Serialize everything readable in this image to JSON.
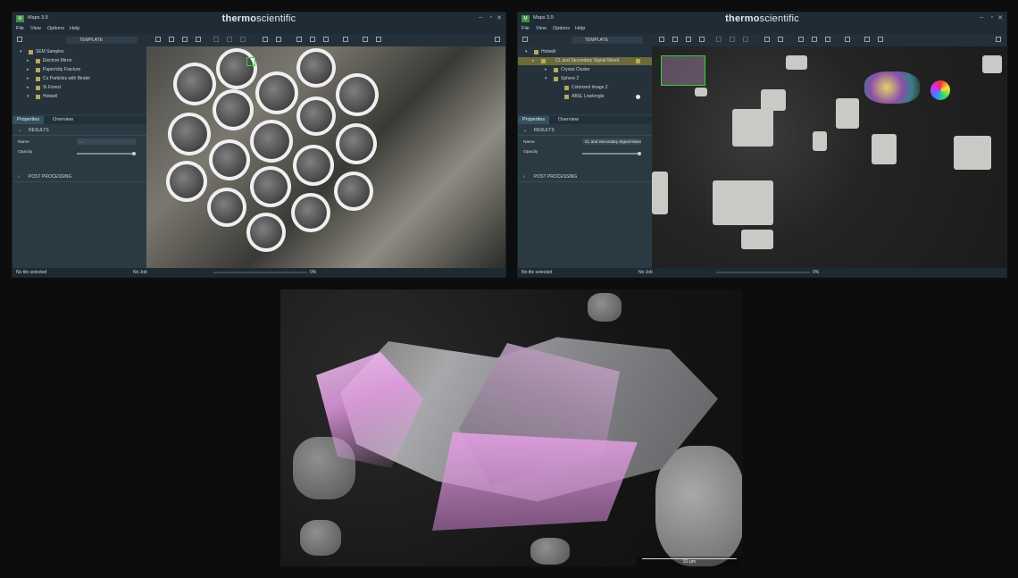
{
  "window_left": {
    "app_title": "Maps 3.9",
    "brand_bold": "thermo",
    "brand_light": "scientific",
    "menu": [
      "File",
      "View",
      "Options",
      "Help"
    ],
    "template_label": "TEMPLATE",
    "tree": [
      {
        "label": "SEM Samples",
        "indent": 0
      },
      {
        "label": "Electron Mirror",
        "indent": 1
      },
      {
        "label": "Paper/clip Fracture",
        "indent": 1
      },
      {
        "label": "Cu Particles with Binder",
        "indent": 1
      },
      {
        "label": "Si Forest",
        "indent": 1
      },
      {
        "label": "Hotwell",
        "indent": 1
      }
    ],
    "tabs": [
      "Properties",
      "Overview"
    ],
    "results_label": "RESULTS",
    "name_label": "Name",
    "name_value": "...",
    "opacity_label": "Opacity",
    "post_processing_label": "POST PROCESSING",
    "status_left": "No tile selected",
    "status_job": "No Job",
    "status_percent": "0%"
  },
  "window_right": {
    "app_title": "Maps 3.9",
    "brand_bold": "thermo",
    "brand_light": "scientific",
    "menu": [
      "File",
      "View",
      "Options",
      "Help"
    ],
    "template_label": "TEMPLATE",
    "tree": [
      {
        "label": "Hotwell",
        "indent": 0
      },
      {
        "label": "CL and Secondary Signal Mixed",
        "indent": 1
      },
      {
        "label": "Crystal Cluster",
        "indent": 1
      },
      {
        "label": "Sphere 2",
        "indent": 1
      },
      {
        "label": "Colorized Image 2",
        "indent": 2
      },
      {
        "label": "ABSL Lowlongle",
        "indent": 2
      }
    ],
    "tabs": [
      "Properties",
      "Overview"
    ],
    "results_label": "RESULTS",
    "name_label": "Name",
    "name_value": "CL and Secondary Signal Mixed",
    "opacity_label": "Opacity",
    "post_processing_label": "POST PROCESSING",
    "status_left": "No tile selected",
    "status_job": "No Job",
    "status_percent": "0%"
  },
  "main_image": {
    "scale_label": "50 µm"
  },
  "colors": {
    "accent_green": "#3f8f46",
    "selection_yellow": "#b9a95a",
    "panel_bg": "#2b3943",
    "highlight_pink": "#e59be4"
  }
}
